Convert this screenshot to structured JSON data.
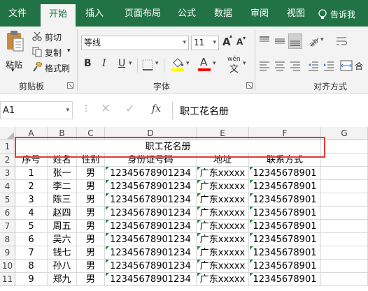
{
  "tabs": [
    "文件",
    "开始",
    "插入",
    "页面布局",
    "公式",
    "数据",
    "审阅",
    "视图"
  ],
  "tell_me": "告诉我",
  "clipboard": {
    "paste": "粘贴",
    "cut": "剪切",
    "copy": "复制",
    "format_painter": "格式刷",
    "group": "剪贴板"
  },
  "font": {
    "name": "等线",
    "size": "11",
    "bold": "B",
    "italic": "I",
    "underline": "U",
    "grow": "A",
    "shrink": "A",
    "font_color_letter": "A",
    "phonetic": "wén",
    "group": "字体"
  },
  "alignment": {
    "group": "对齐方式",
    "merge": "合"
  },
  "formula_bar": {
    "name_box": "A1",
    "fx": "fx",
    "content": "职工花名册"
  },
  "columns": [
    "A",
    "B",
    "C",
    "D",
    "E",
    "F",
    "G"
  ],
  "rows": [
    "1",
    "2",
    "3",
    "4",
    "5",
    "6",
    "7",
    "8",
    "9",
    "10",
    "11"
  ],
  "sheet": {
    "title": "职工花名册",
    "headers": [
      "序号",
      "姓名",
      "性别",
      "身份证号码",
      "地址",
      "联系方式"
    ],
    "data": [
      [
        "1",
        "张一",
        "男",
        "12345678901234",
        "广东xxxxx",
        "12345678901"
      ],
      [
        "2",
        "李二",
        "男",
        "12345678901234",
        "广东xxxxx",
        "12345678901"
      ],
      [
        "3",
        "陈三",
        "男",
        "12345678901234",
        "广东xxxxx",
        "12345678901"
      ],
      [
        "4",
        "赵四",
        "男",
        "12345678901234",
        "广东xxxxx",
        "12345678901"
      ],
      [
        "5",
        "周五",
        "男",
        "12345678901234",
        "广东xxxxx",
        "12345678901"
      ],
      [
        "6",
        "吴六",
        "男",
        "12345678901234",
        "广东xxxxx",
        "12345678901"
      ],
      [
        "7",
        "钱七",
        "男",
        "12345678901234",
        "广东xxxxx",
        "12345678901"
      ],
      [
        "8",
        "孙八",
        "男",
        "12345678901234",
        "广东xxxxx",
        "12345678901"
      ],
      [
        "9",
        "郑九",
        "男",
        "12345678901234",
        "广东xxxxx",
        "12345678901"
      ]
    ]
  },
  "colors": {
    "excel_green": "#217346",
    "highlight_yellow": "#ffff00",
    "font_red": "#ff0000",
    "selection_border": "#e53935"
  }
}
